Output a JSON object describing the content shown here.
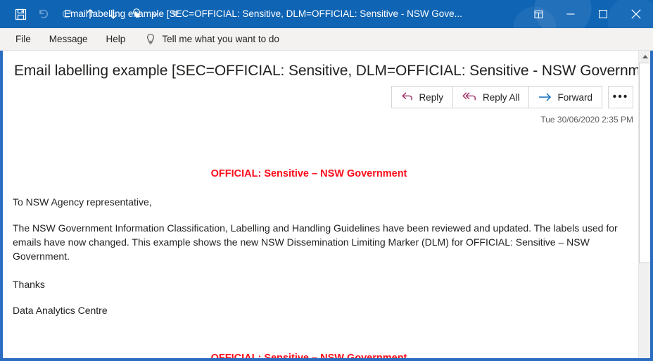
{
  "window": {
    "title": "Email labelling example [SEC=OFFICIAL: Sensitive, DLM=OFFICIAL: Sensitive - NSW Gove...",
    "quick_access": [
      {
        "name": "save-icon",
        "label": "Save"
      },
      {
        "name": "undo-icon",
        "label": "Undo"
      },
      {
        "name": "redo-icon",
        "label": "Redo"
      },
      {
        "name": "previous-item-icon",
        "label": "Previous Item"
      },
      {
        "name": "next-item-icon",
        "label": "Next Item"
      },
      {
        "name": "touch-mode-icon",
        "label": "Touch/Mouse Mode"
      },
      {
        "name": "touch-mode-dropdown-icon",
        "label": "Touch/Mouse Mode options"
      },
      {
        "name": "customize-quick-access-toolbar-icon",
        "label": "Customize Quick Access Toolbar"
      }
    ],
    "controls": {
      "restore_down_label": "Restore Down",
      "minimize_label": "Minimize",
      "maximize_label": "Maximize",
      "close_label": "Close"
    },
    "titlebar_color": "#0f64b4",
    "border_color": "#2a6cc0"
  },
  "ribbon": {
    "tabs": [
      {
        "label": "File"
      },
      {
        "label": "Message"
      },
      {
        "label": "Help"
      }
    ],
    "tell_me": {
      "icon": "lightbulb-icon",
      "placeholder": "Tell me what you want to do"
    }
  },
  "message": {
    "subject": "Email labelling example [SEC=OFFICIAL: Sensitive, DLM=OFFICIAL: Sensitive - NSW Government]",
    "timestamp": "Tue 30/06/2020 2:35 PM",
    "actions": [
      {
        "label": "Reply",
        "icon": "reply-arrow-icon",
        "color": "#a4376f"
      },
      {
        "label": "Reply All",
        "icon": "reply-all-arrow-icon",
        "color": "#a4376f"
      },
      {
        "label": "Forward",
        "icon": "forward-arrow-icon",
        "color": "#0f6cbd"
      }
    ],
    "more_actions_label": "•••",
    "classification_top": "OFFICIAL: Sensitive – NSW Government",
    "classification_bottom": "OFFICIAL: Sensitive – NSW Government",
    "classification_color": "#fc0d1b",
    "body": {
      "salutation": "To NSW Agency representative,",
      "paragraph": "The NSW Government Information Classification, Labelling and Handling Guidelines have been reviewed and updated. The labels used for emails have now changed. This example shows the new NSW Dissemination Limiting Marker (DLM) for OFFICIAL: Sensitive – NSW Government.",
      "closing": "Thanks",
      "signature": "Data Analytics Centre"
    }
  },
  "scrollbar": {
    "up_arrow_label": "Scroll up",
    "thumb_label": "Vertical scrollbar thumb"
  }
}
